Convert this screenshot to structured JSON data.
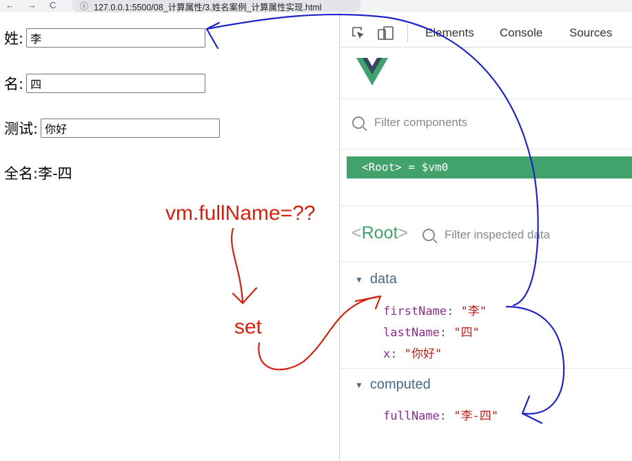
{
  "browser": {
    "nav_glyphs": [
      "←",
      "→",
      "C"
    ],
    "url": "127.0.0.1:5500/08_计算属性/3.姓名案例_计算属性实现.html",
    "info_icon": "info-icon"
  },
  "page": {
    "first_label": "姓:",
    "first_value": "李",
    "last_label": "名:",
    "last_value": "四",
    "test_label": "测试:",
    "test_value": "你好",
    "full_label": "全名:",
    "full_value": "李-四"
  },
  "devtools": {
    "tabs": [
      "Elements",
      "Console",
      "Sources"
    ],
    "filter_components_placeholder": "Filter components",
    "root_component": "<Root> = $vm0",
    "inspect_open": "<",
    "inspect_name": "Root",
    "inspect_close": ">",
    "filter_inspected_placeholder": "Filter inspected data",
    "data_section": "data",
    "data_props": [
      {
        "key": "firstName",
        "value": "\"李\""
      },
      {
        "key": "lastName",
        "value": "\"四\""
      },
      {
        "key": "x",
        "value": "\"你好\""
      }
    ],
    "computed_section": "computed",
    "computed_props": [
      {
        "key": "fullName",
        "value": "\"李-四\""
      }
    ]
  },
  "annotations": {
    "question": "vm.fullName=??",
    "set_label": "set",
    "red_color": "#d4210d",
    "blue_color": "#1c22c9"
  },
  "colors": {
    "vue_green": "#41a36b",
    "vue_dark": "#34495e"
  }
}
